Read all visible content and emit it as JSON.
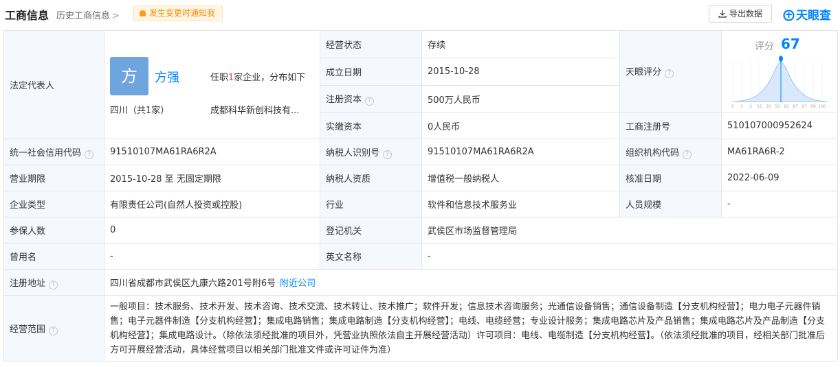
{
  "header": {
    "title": "工商信息",
    "history": "历史工商信息",
    "history_chevron": ">",
    "notify": "发生变更时通知我",
    "export": "导出数据",
    "brand": "天眼查"
  },
  "legal": {
    "label": "法定代表人",
    "avatar": "方",
    "name": "方强",
    "desc_prefix": "任职",
    "desc_count": "1",
    "desc_suffix": "家企业，分布如下",
    "region": "四川（共1家）",
    "company": "成都科华新创科技有..."
  },
  "score": {
    "label": "天眼评分",
    "title": "评分",
    "value": 67,
    "ticks": [
      "0",
      "1",
      "3",
      "15",
      "30",
      "50",
      "65",
      "87",
      "97",
      "99",
      "100"
    ]
  },
  "rows": {
    "status": {
      "label": "经营状态",
      "value": "存续"
    },
    "founded": {
      "label": "成立日期",
      "value": "2015-10-28"
    },
    "capital": {
      "label": "注册资本",
      "value": "500万人民币"
    },
    "paid": {
      "label": "实缴资本",
      "value": "0人民币"
    },
    "regno": {
      "label": "工商注册号",
      "value": "510107000952624"
    },
    "credit": {
      "label": "统一社会信用代码",
      "value": "91510107MA61RA6R2A"
    },
    "taxid": {
      "label": "纳税人识别号",
      "value": "91510107MA61RA6R2A"
    },
    "orgcode": {
      "label": "组织机构代码",
      "value": "MA61RA6R-2"
    },
    "period": {
      "label": "营业期限",
      "value": "2015-10-28 至 无固定期限"
    },
    "taxqual": {
      "label": "纳税人资质",
      "value": "增值税一般纳税人"
    },
    "approved": {
      "label": "核准日期",
      "value": "2022-06-09"
    },
    "type": {
      "label": "企业类型",
      "value": "有限责任公司(自然人投资或控股)"
    },
    "industry": {
      "label": "行业",
      "value": "软件和信息技术服务业"
    },
    "staff": {
      "label": "人员规模",
      "value": "-"
    },
    "insured": {
      "label": "参保人数",
      "value": "0"
    },
    "authority": {
      "label": "登记机关",
      "value": "武侯区市场监督管理局"
    },
    "former": {
      "label": "曾用名",
      "value": "-"
    },
    "english": {
      "label": "英文名称",
      "value": "-"
    },
    "address": {
      "label": "注册地址",
      "value": "四川省成都市武侯区九康六路201号附6号",
      "link": "附近公司"
    },
    "scope": {
      "label": "经营范围",
      "value": "一般项目：技术服务、技术开发、技术咨询、技术交流、技术转让、技术推广；软件开发；信息技术咨询服务；光通信设备销售；通信设备制造【分支机构经营】；电力电子元器件销售；电子元器件制造【分支机构经营】；集成电路销售；集成电路制造【分支机构经营】；电线、电缆经营；专业设计服务；集成电路芯片及产品销售；集成电路芯片及产品制造【分支机构经营】；集成电路设计。（除依法须经批准的项目外，凭营业执照依法自主开展经营活动）许可项目：电线、电缆制造【分支机构经营】。（依法须经批准的项目，经相关部门批准后方可开展经营活动，具体经营项目以相关部门批准文件或许可证件为准）"
    }
  },
  "colors": {
    "accent": "#0084ff",
    "label_bg": "#f5f9ff",
    "notify": "#ff8a00",
    "highlight": "#ff3b3b"
  }
}
